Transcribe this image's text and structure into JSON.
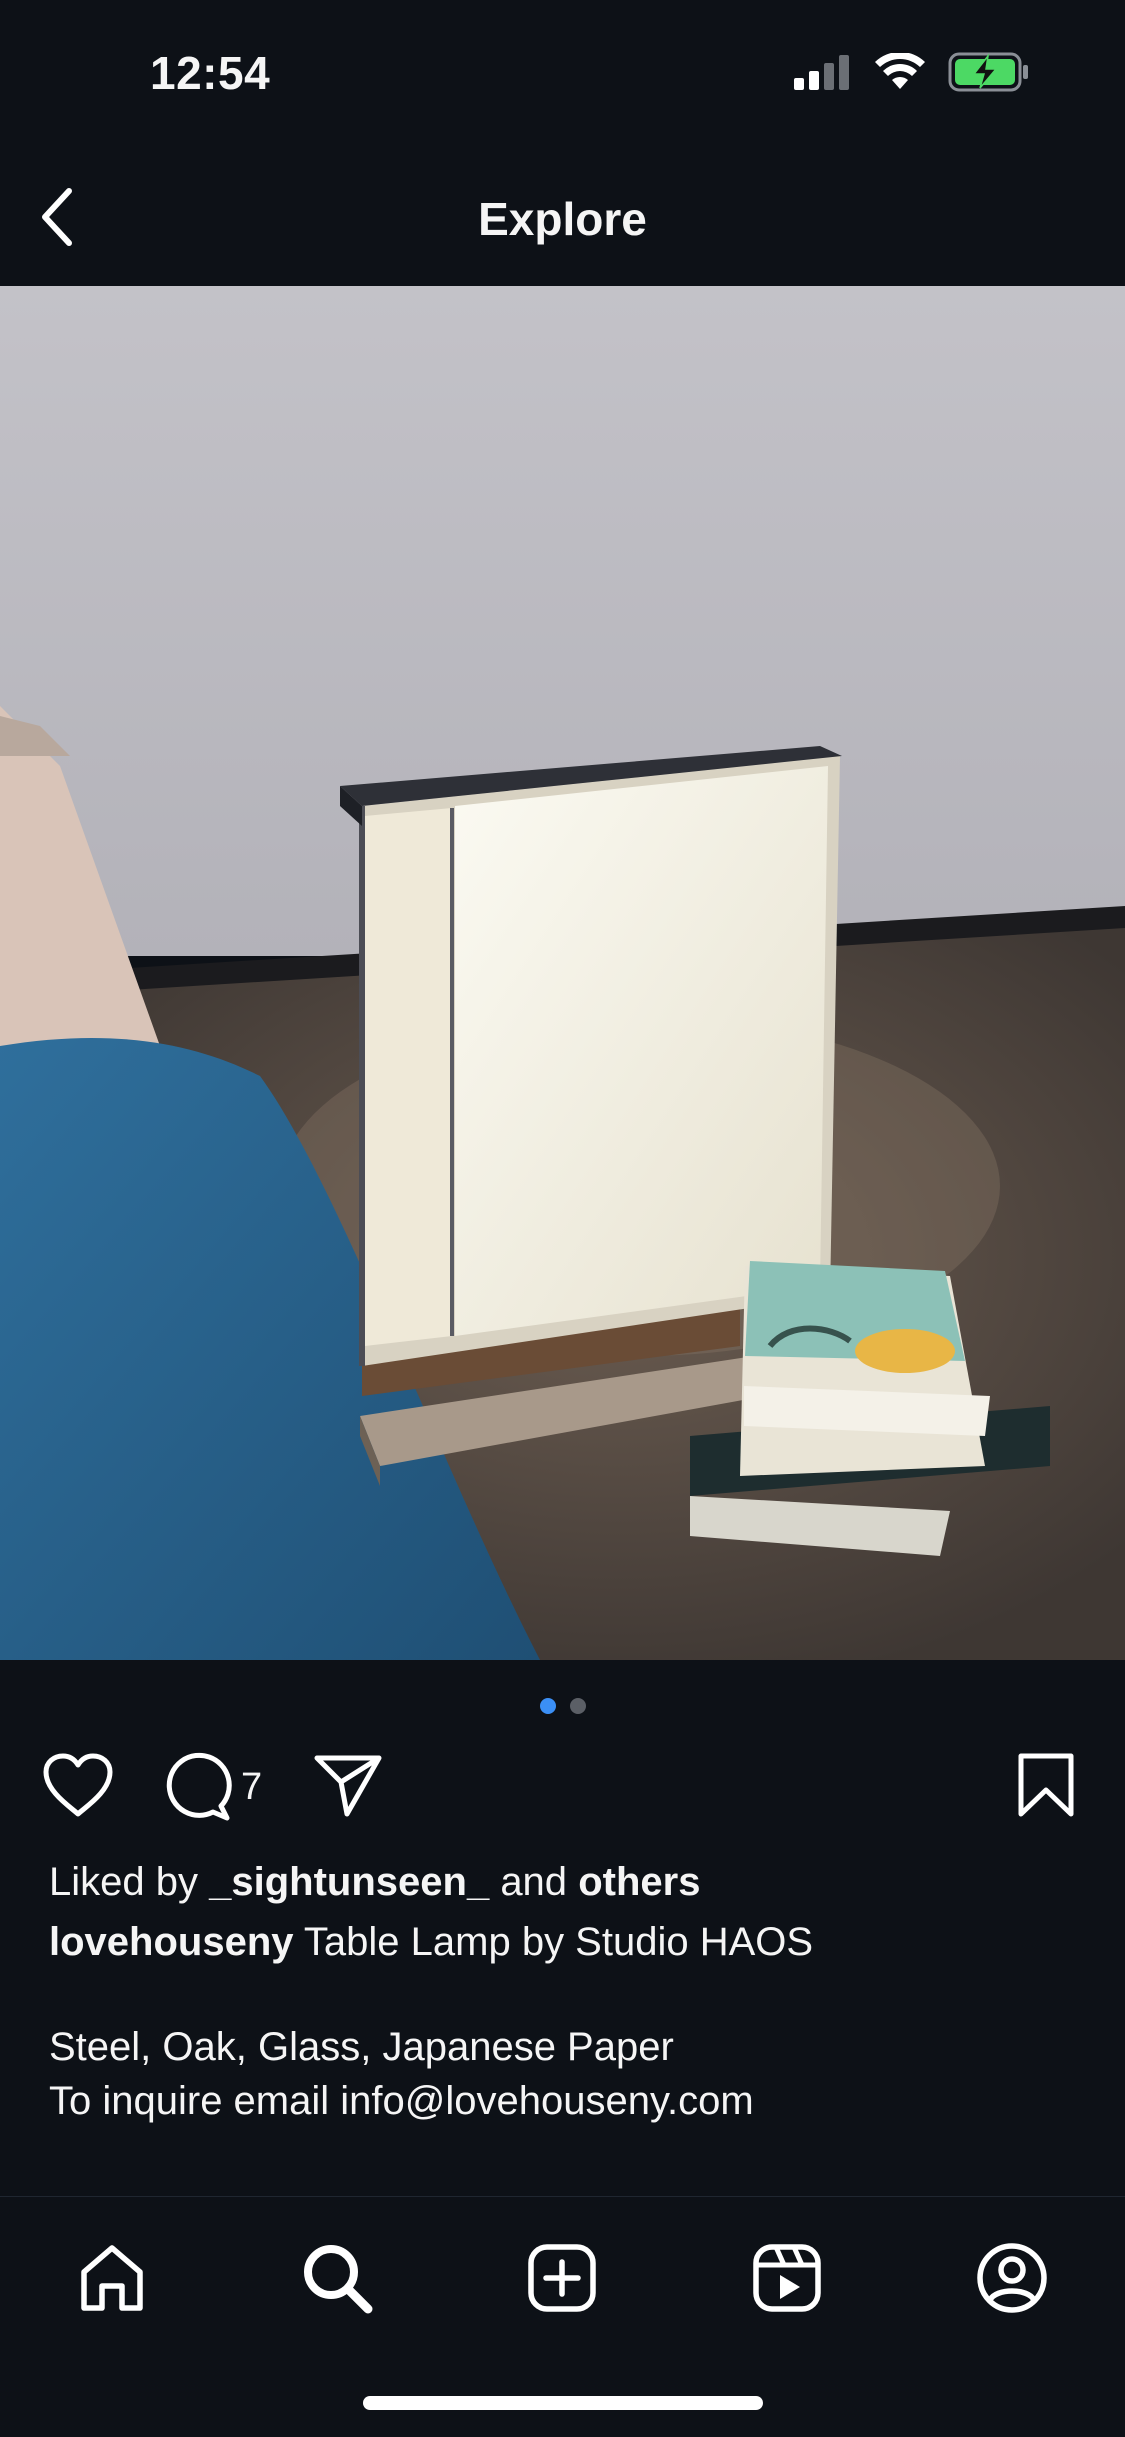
{
  "status_bar": {
    "time": "12:54"
  },
  "nav": {
    "title": "Explore"
  },
  "post": {
    "comment_count": "7",
    "carousel": {
      "total": 2,
      "active_index": 1
    },
    "liked_by": {
      "prefix": "Liked by",
      "user": "_sightunseen_",
      "joiner": "and",
      "others": "others"
    },
    "caption": {
      "username": "lovehouseny",
      "text": "Table Lamp by Studio HAOS",
      "line2": "Steel, Oak, Glass, Japanese Paper",
      "line3": "To inquire email info@lovehouseny.com"
    }
  },
  "tab_bar": {
    "items": [
      "home-icon",
      "search-icon",
      "create-icon",
      "reels-icon",
      "profile-icon"
    ],
    "active": "search"
  },
  "colors": {
    "background": "#0d1117",
    "accent_dot": "#3b8ff5",
    "battery": "#4cd964"
  }
}
